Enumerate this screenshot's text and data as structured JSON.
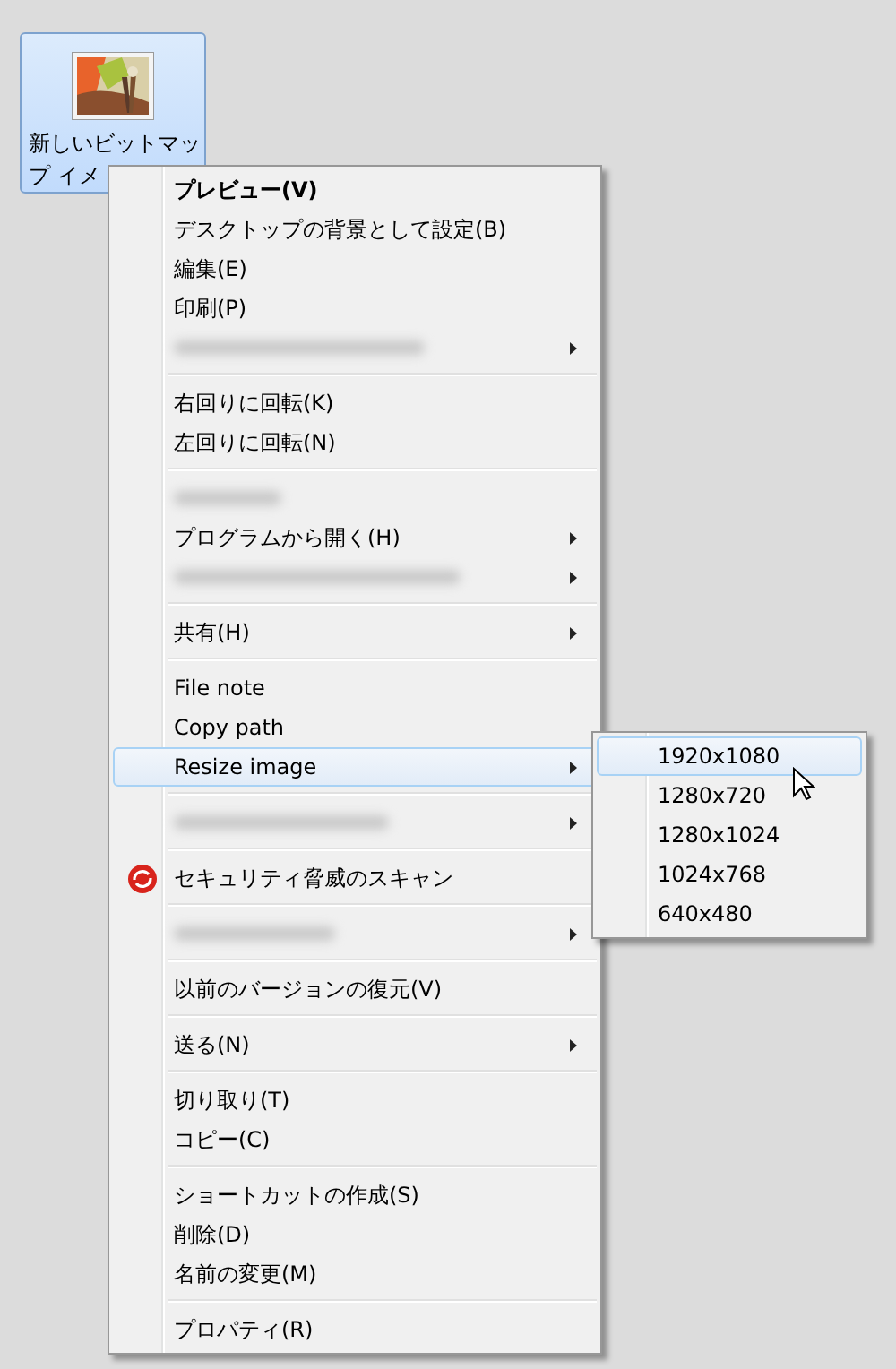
{
  "desktop_icon": {
    "label_lines": [
      "新しいビットマッ",
      "プ イメ"
    ],
    "selected": true
  },
  "context_menu": {
    "items": [
      {
        "kind": "item",
        "label": "プレビュー(V)",
        "bold": true,
        "submenu": false,
        "selected": false
      },
      {
        "kind": "item",
        "label": "デスクトップの背景として設定(B)",
        "bold": false,
        "submenu": false,
        "selected": false
      },
      {
        "kind": "item",
        "label": "編集(E)",
        "bold": false,
        "submenu": false,
        "selected": false
      },
      {
        "kind": "item",
        "label": "印刷(P)",
        "bold": false,
        "submenu": false,
        "selected": false
      },
      {
        "kind": "blurred",
        "submenu": true
      },
      {
        "kind": "separator"
      },
      {
        "kind": "item",
        "label": "右回りに回転(K)",
        "bold": false,
        "submenu": false,
        "selected": false
      },
      {
        "kind": "item",
        "label": "左回りに回転(N)",
        "bold": false,
        "submenu": false,
        "selected": false
      },
      {
        "kind": "separator"
      },
      {
        "kind": "blurred",
        "submenu": false
      },
      {
        "kind": "item",
        "label": "プログラムから開く(H)",
        "bold": false,
        "submenu": true,
        "selected": false
      },
      {
        "kind": "blurred",
        "submenu": true
      },
      {
        "kind": "separator"
      },
      {
        "kind": "item",
        "label": "共有(H)",
        "bold": false,
        "submenu": true,
        "selected": false
      },
      {
        "kind": "separator"
      },
      {
        "kind": "item",
        "label": "File note",
        "bold": false,
        "submenu": false,
        "selected": false
      },
      {
        "kind": "item",
        "label": "Copy path",
        "bold": false,
        "submenu": false,
        "selected": false
      },
      {
        "kind": "item",
        "label": "Resize image",
        "bold": false,
        "submenu": true,
        "selected": true
      },
      {
        "kind": "separator"
      },
      {
        "kind": "blurred",
        "submenu": true
      },
      {
        "kind": "separator"
      },
      {
        "kind": "item",
        "label": "セキュリティ脅威のスキャン",
        "bold": false,
        "submenu": false,
        "selected": false,
        "has_icon": true
      },
      {
        "kind": "separator"
      },
      {
        "kind": "blurred",
        "submenu": true
      },
      {
        "kind": "separator"
      },
      {
        "kind": "item",
        "label": "以前のバージョンの復元(V)",
        "bold": false,
        "submenu": false,
        "selected": false
      },
      {
        "kind": "separator"
      },
      {
        "kind": "item",
        "label": "送る(N)",
        "bold": false,
        "submenu": true,
        "selected": false
      },
      {
        "kind": "separator"
      },
      {
        "kind": "item",
        "label": "切り取り(T)",
        "bold": false,
        "submenu": false,
        "selected": false
      },
      {
        "kind": "item",
        "label": "コピー(C)",
        "bold": false,
        "submenu": false,
        "selected": false
      },
      {
        "kind": "separator"
      },
      {
        "kind": "item",
        "label": "ショートカットの作成(S)",
        "bold": false,
        "submenu": false,
        "selected": false
      },
      {
        "kind": "item",
        "label": "削除(D)",
        "bold": false,
        "submenu": false,
        "selected": false
      },
      {
        "kind": "item",
        "label": "名前の変更(M)",
        "bold": false,
        "submenu": false,
        "selected": false
      },
      {
        "kind": "separator"
      },
      {
        "kind": "item",
        "label": "プロパティ(R)",
        "bold": false,
        "submenu": false,
        "selected": false
      }
    ]
  },
  "submenu": {
    "items": [
      {
        "label": "1920x1080",
        "selected": true
      },
      {
        "label": "1280x720",
        "selected": false
      },
      {
        "label": "1280x1024",
        "selected": false
      },
      {
        "label": "1024x768",
        "selected": false
      },
      {
        "label": "640x480",
        "selected": false
      }
    ]
  }
}
